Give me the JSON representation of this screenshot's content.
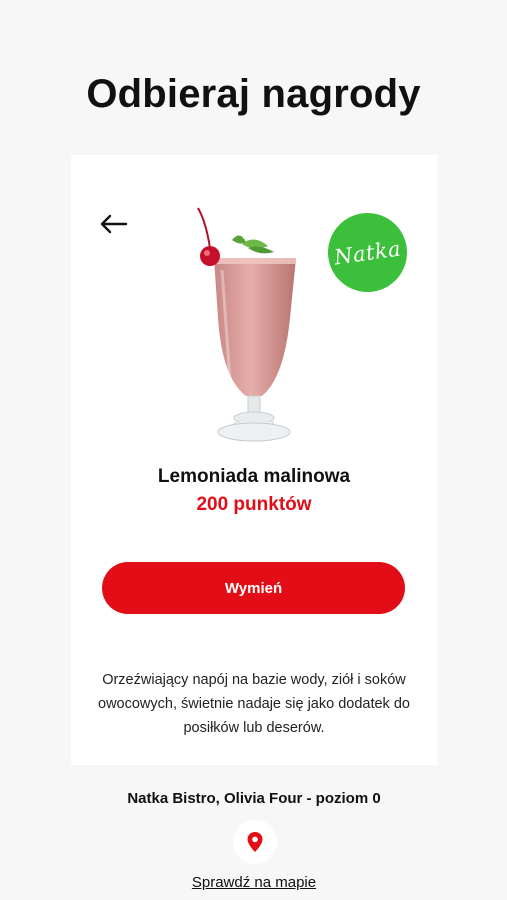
{
  "page": {
    "title": "Odbieraj nagrody"
  },
  "reward": {
    "name": "Lemoniada malinowa",
    "points": "200 punktów",
    "redeem_label": "Wymień",
    "description": "Orzeźwiający napój na bazie wody, ziół i soków owocowych, świetnie nadaje się jako dodatek do posiłków lub deserów.",
    "product_image_icon": "milkshake-glass-icon"
  },
  "brand": {
    "logo_text": "Natka",
    "color": "#3cbf3a"
  },
  "location": {
    "name": "Natka Bistro, Olivia Four - poziom 0",
    "map_link": "Sprawdź na mapie",
    "pin_icon": "location-pin-icon"
  },
  "colors": {
    "accent": "#e30d17",
    "background": "#f7f7f7",
    "card": "#ffffff"
  }
}
